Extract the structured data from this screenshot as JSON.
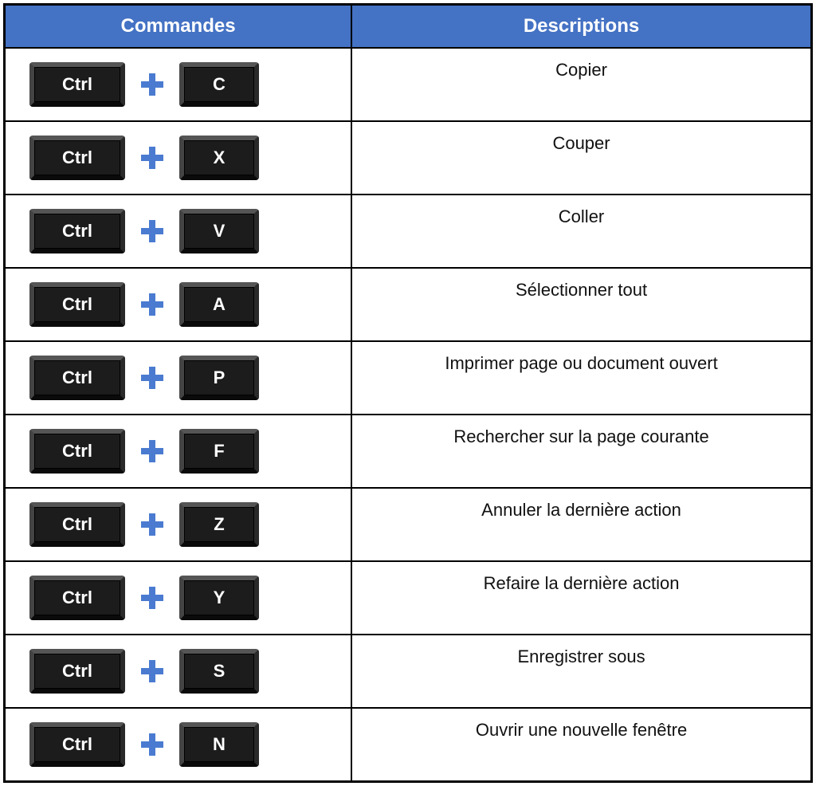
{
  "headers": {
    "commands": "Commandes",
    "descriptions": "Descriptions"
  },
  "rows": [
    {
      "key1": "Ctrl",
      "key2": "C",
      "description": "Copier"
    },
    {
      "key1": "Ctrl",
      "key2": "X",
      "description": "Couper"
    },
    {
      "key1": "Ctrl",
      "key2": "V",
      "description": "Coller"
    },
    {
      "key1": "Ctrl",
      "key2": "A",
      "description": "Sélectionner tout"
    },
    {
      "key1": "Ctrl",
      "key2": "P",
      "description": "Imprimer page ou document ouvert"
    },
    {
      "key1": "Ctrl",
      "key2": "F",
      "description": "Rechercher sur la page courante"
    },
    {
      "key1": "Ctrl",
      "key2": "Z",
      "description": "Annuler la dernière action"
    },
    {
      "key1": "Ctrl",
      "key2": "Y",
      "description": "Refaire la dernière action"
    },
    {
      "key1": "Ctrl",
      "key2": "S",
      "description": "Enregistrer sous"
    },
    {
      "key1": "Ctrl",
      "key2": "N",
      "description": "Ouvrir une nouvelle fenêtre"
    }
  ],
  "colors": {
    "header_bg": "#4472c4",
    "plus_icon": "#4a7bd0"
  }
}
